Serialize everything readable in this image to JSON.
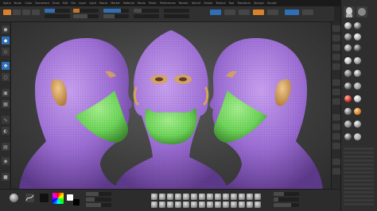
{
  "app": {
    "title": "ZBrush"
  },
  "menubar": {
    "items": [
      "Alpha",
      "Brush",
      "Color",
      "Document",
      "Draw",
      "Edit",
      "File",
      "Layer",
      "Light",
      "Macro",
      "Marker",
      "Material",
      "Movie",
      "Picker",
      "Preferences",
      "Render",
      "Stencil",
      "Stroke",
      "Texture",
      "Tool",
      "Transform",
      "Zplugin",
      "Zscript"
    ]
  },
  "colors": {
    "skin_purple": "#9d6ed6",
    "mask_green": "#6ed65a",
    "ear_tan": "#d6a35a",
    "accent_orange": "#d9822b",
    "accent_blue": "#2f6fb5"
  },
  "bottom": {
    "icons": [
      "sphere-brush-icon",
      "stroke-icon",
      "alpha-icon",
      "texture-icon",
      "material-icon",
      "color-picker-icon"
    ]
  }
}
